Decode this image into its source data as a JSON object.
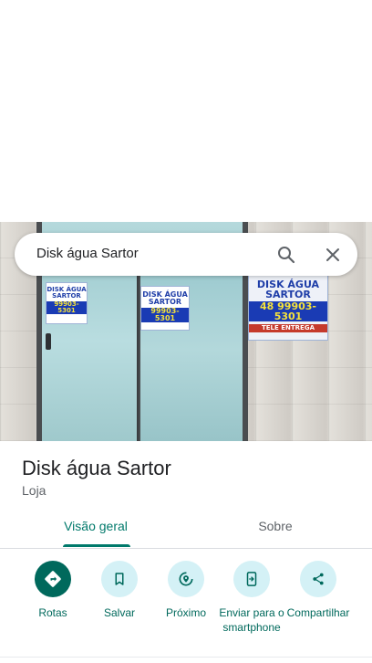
{
  "search": {
    "query": "Disk água Sartor"
  },
  "photo": {
    "sign_a": {
      "line1": "DISK ÁGUA",
      "line2": "SARTOR",
      "phone": "99903-5301"
    },
    "sign_b": {
      "line1": "DISK ÁGUA",
      "line2": "SARTOR",
      "phone": "99903-5301"
    },
    "sign_c": {
      "line1": "DISK ÁGUA",
      "line2": "SARTOR",
      "phone": "48 99903-5301",
      "delivery": "TELE ENTREGA"
    }
  },
  "place": {
    "name": "Disk água Sartor",
    "category": "Loja"
  },
  "tabs": [
    {
      "label": "Visão geral",
      "active": true
    },
    {
      "label": "Sobre",
      "active": false
    }
  ],
  "actions": [
    {
      "label": "Rotas",
      "icon": "directions-icon"
    },
    {
      "label": "Salvar",
      "icon": "bookmark-icon"
    },
    {
      "label": "Próximo",
      "icon": "nearby-icon"
    },
    {
      "label": "Enviar para o smartphone",
      "icon": "send-to-phone-icon"
    },
    {
      "label": "Compartilhar",
      "icon": "share-icon"
    }
  ],
  "colors": {
    "accent": "#00796b",
    "action_bg": "#d4f1f6",
    "primary_action_bg": "#00695c"
  }
}
